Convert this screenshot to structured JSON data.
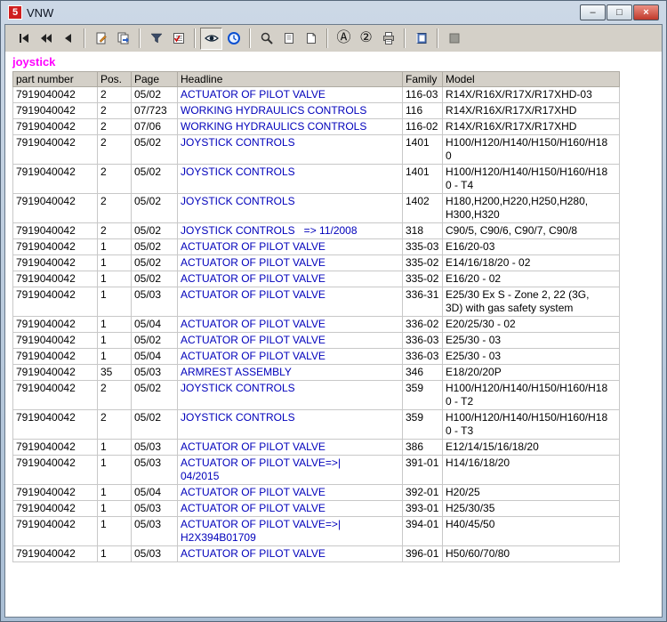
{
  "window": {
    "title": "VNW",
    "icon_text": "5",
    "controls": {
      "minimize": "–",
      "maximize": "□",
      "close": "×"
    }
  },
  "toolbar": {
    "icons": [
      "first-record-icon",
      "fast-back-icon",
      "back-icon",
      "edit-page-icon",
      "pages-goto-icon",
      "funnel-filter-icon",
      "checklist-icon",
      "eye-icon",
      "clock-icon",
      "magnifier-zoom-icon",
      "page-view-icon",
      "page-fit-icon",
      "circled-a-icon",
      "circled-2-icon",
      "printer-icon",
      "book-icon",
      "stop-icon"
    ],
    "glyph_a": "Ⓐ",
    "glyph_2": "②"
  },
  "search_term": "joystick",
  "table": {
    "columns": [
      "part number",
      "Pos.",
      "Page",
      "Headline",
      "Family",
      "Model"
    ],
    "rows": [
      {
        "part_number": "7919040042",
        "pos": "2",
        "page": "05/02",
        "headline": "ACTUATOR OF PILOT VALVE",
        "family": "116-03",
        "model": "R14X/R16X/R17X/R17XHD-03"
      },
      {
        "part_number": "7919040042",
        "pos": "2",
        "page": "07/723",
        "headline": "WORKING HYDRAULICS CONTROLS",
        "family": "116",
        "model": "R14X/R16X/R17X/R17XHD"
      },
      {
        "part_number": "7919040042",
        "pos": "2",
        "page": "07/06",
        "headline": "WORKING HYDRAULICS CONTROLS",
        "family": "116-02",
        "model": "R14X/R16X/R17X/R17XHD"
      },
      {
        "part_number": "7919040042",
        "pos": "2",
        "page": "05/02",
        "headline": "JOYSTICK CONTROLS",
        "family": "1401",
        "model": "H100/H120/H140/H150/H160/H18\n0"
      },
      {
        "part_number": "7919040042",
        "pos": "2",
        "page": "05/02",
        "headline": "JOYSTICK CONTROLS",
        "family": "1401",
        "model": "H100/H120/H140/H150/H160/H18\n0 - T4"
      },
      {
        "part_number": "7919040042",
        "pos": "2",
        "page": "05/02",
        "headline": "JOYSTICK CONTROLS",
        "family": "1402",
        "model": "H180,H200,H220,H250,H280,\nH300,H320"
      },
      {
        "part_number": "7919040042",
        "pos": "2",
        "page": "05/02",
        "headline": "JOYSTICK CONTROLS   => 11/2008",
        "family": "318",
        "model": "C90/5, C90/6, C90/7, C90/8"
      },
      {
        "part_number": "7919040042",
        "pos": "1",
        "page": "05/02",
        "headline": "ACTUATOR OF PILOT VALVE",
        "family": "335-03",
        "model": "E16/20-03"
      },
      {
        "part_number": "7919040042",
        "pos": "1",
        "page": "05/02",
        "headline": "ACTUATOR OF PILOT VALVE",
        "family": "335-02",
        "model": "E14/16/18/20 - 02"
      },
      {
        "part_number": "7919040042",
        "pos": "1",
        "page": "05/02",
        "headline": "ACTUATOR OF PILOT VALVE",
        "family": "335-02",
        "model": "E16/20 - 02"
      },
      {
        "part_number": "7919040042",
        "pos": "1",
        "page": "05/03",
        "headline": "ACTUATOR OF PILOT VALVE",
        "family": "336-31",
        "model": "E25/30 Ex S - Zone 2, 22 (3G,\n3D) with gas safety system"
      },
      {
        "part_number": "7919040042",
        "pos": "1",
        "page": "05/04",
        "headline": "ACTUATOR OF PILOT VALVE",
        "family": "336-02",
        "model": "E20/25/30 - 02"
      },
      {
        "part_number": "7919040042",
        "pos": "1",
        "page": "05/02",
        "headline": "ACTUATOR OF PILOT VALVE",
        "family": "336-03",
        "model": "E25/30 - 03"
      },
      {
        "part_number": "7919040042",
        "pos": "1",
        "page": "05/04",
        "headline": "ACTUATOR OF PILOT VALVE",
        "family": "336-03",
        "model": "E25/30 - 03"
      },
      {
        "part_number": "7919040042",
        "pos": "35",
        "page": "05/03",
        "headline": "ARMREST ASSEMBLY",
        "family": "346",
        "model": "E18/20/20P"
      },
      {
        "part_number": "7919040042",
        "pos": "2",
        "page": "05/02",
        "headline": "JOYSTICK CONTROLS",
        "family": "359",
        "model": "H100/H120/H140/H150/H160/H18\n0 - T2"
      },
      {
        "part_number": "7919040042",
        "pos": "2",
        "page": "05/02",
        "headline": "JOYSTICK CONTROLS",
        "family": "359",
        "model": "H100/H120/H140/H150/H160/H18\n0 - T3"
      },
      {
        "part_number": "7919040042",
        "pos": "1",
        "page": "05/03",
        "headline": "ACTUATOR OF PILOT VALVE",
        "family": "386",
        "model": "E12/14/15/16/18/20"
      },
      {
        "part_number": "7919040042",
        "pos": "1",
        "page": "05/03",
        "headline": "ACTUATOR OF PILOT VALVE=>|\n04/2015",
        "family": "391-01",
        "model": "H14/16/18/20"
      },
      {
        "part_number": "7919040042",
        "pos": "1",
        "page": "05/04",
        "headline": "ACTUATOR OF PILOT VALVE",
        "family": "392-01",
        "model": "H20/25"
      },
      {
        "part_number": "7919040042",
        "pos": "1",
        "page": "05/03",
        "headline": "ACTUATOR OF PILOT VALVE",
        "family": "393-01",
        "model": "H25/30/35"
      },
      {
        "part_number": "7919040042",
        "pos": "1",
        "page": "05/03",
        "headline": "ACTUATOR OF PILOT VALVE=>|\nH2X394B01709",
        "family": "394-01",
        "model": "H40/45/50"
      },
      {
        "part_number": "7919040042",
        "pos": "1",
        "page": "05/03",
        "headline": "ACTUATOR OF PILOT VALVE",
        "family": "396-01",
        "model": "H50/60/70/80"
      }
    ]
  },
  "colors": {
    "link_blue": "#0000bb",
    "search_magenta": "#ff00ff",
    "header_bg": "#d4d0c8",
    "toolbar_bg": "#d4d0c8",
    "close_red": "#c0392b"
  }
}
